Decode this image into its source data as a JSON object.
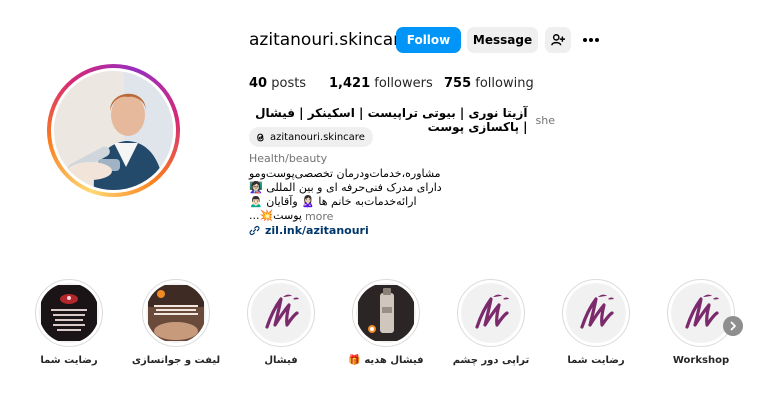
{
  "profile": {
    "username": "azitanouri.skincare",
    "follow_label": "Follow",
    "message_label": "Message",
    "stats": {
      "posts_count": "40",
      "posts_label": "posts",
      "followers_count": "1,421",
      "followers_label": "followers",
      "following_count": "755",
      "following_label": "following"
    },
    "full_name": "آزیتا نوری | بیوتی تراپیست | اسکینکر | فیشال | پاکسازی پوست",
    "pronoun": "she",
    "threads_handle": "azitanouri.skincare",
    "category": "Health/beauty",
    "bio": [
      "مشاوره،خدمات‌ودرمان تخصصی‌پوست‌ومو",
      "دارای مدرک فنی‌حرفه ای و بین المللی 👩🏻‍🏫",
      "ارائه‌خدمات‌به خانم ها 🙎🏻‍♀️ وآقایان 🙍🏻‍♂️",
      "پوست💥..."
    ],
    "more_label": "more",
    "link": "zil.ink/azitanouri"
  },
  "highlights": [
    {
      "label": "رضایت شما",
      "style": "dark"
    },
    {
      "label": "لیفت و جوانسازی",
      "style": "photo"
    },
    {
      "label": "فیشال",
      "style": "logo"
    },
    {
      "label": "فیشال هدیه 🎁",
      "style": "bottle"
    },
    {
      "label": "تراپی دور چشم",
      "style": "logo"
    },
    {
      "label": "رضایت شما",
      "style": "logo"
    },
    {
      "label": "Workshop",
      "style": "logo"
    }
  ],
  "icons": {
    "add_user": "person-plus-icon",
    "more": "more-horizontal-icon",
    "threads": "threads-icon",
    "link": "link-icon",
    "next": "chevron-right-icon"
  },
  "colors": {
    "accent": "#0095f6",
    "brand_purple": "#7b2a6c",
    "link": "#00376b"
  }
}
